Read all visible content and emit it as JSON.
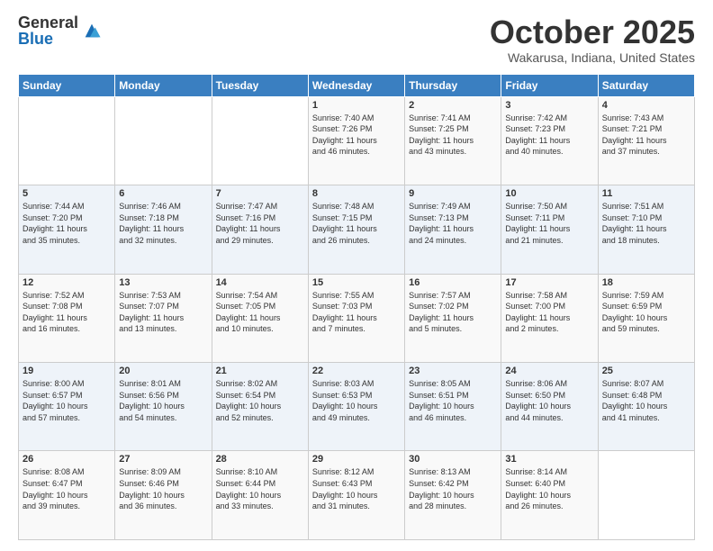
{
  "logo": {
    "general": "General",
    "blue": "Blue"
  },
  "header": {
    "month": "October 2025",
    "location": "Wakarusa, Indiana, United States"
  },
  "weekdays": [
    "Sunday",
    "Monday",
    "Tuesday",
    "Wednesday",
    "Thursday",
    "Friday",
    "Saturday"
  ],
  "weeks": [
    [
      {
        "day": "",
        "info": ""
      },
      {
        "day": "",
        "info": ""
      },
      {
        "day": "",
        "info": ""
      },
      {
        "day": "1",
        "info": "Sunrise: 7:40 AM\nSunset: 7:26 PM\nDaylight: 11 hours\nand 46 minutes."
      },
      {
        "day": "2",
        "info": "Sunrise: 7:41 AM\nSunset: 7:25 PM\nDaylight: 11 hours\nand 43 minutes."
      },
      {
        "day": "3",
        "info": "Sunrise: 7:42 AM\nSunset: 7:23 PM\nDaylight: 11 hours\nand 40 minutes."
      },
      {
        "day": "4",
        "info": "Sunrise: 7:43 AM\nSunset: 7:21 PM\nDaylight: 11 hours\nand 37 minutes."
      }
    ],
    [
      {
        "day": "5",
        "info": "Sunrise: 7:44 AM\nSunset: 7:20 PM\nDaylight: 11 hours\nand 35 minutes."
      },
      {
        "day": "6",
        "info": "Sunrise: 7:46 AM\nSunset: 7:18 PM\nDaylight: 11 hours\nand 32 minutes."
      },
      {
        "day": "7",
        "info": "Sunrise: 7:47 AM\nSunset: 7:16 PM\nDaylight: 11 hours\nand 29 minutes."
      },
      {
        "day": "8",
        "info": "Sunrise: 7:48 AM\nSunset: 7:15 PM\nDaylight: 11 hours\nand 26 minutes."
      },
      {
        "day": "9",
        "info": "Sunrise: 7:49 AM\nSunset: 7:13 PM\nDaylight: 11 hours\nand 24 minutes."
      },
      {
        "day": "10",
        "info": "Sunrise: 7:50 AM\nSunset: 7:11 PM\nDaylight: 11 hours\nand 21 minutes."
      },
      {
        "day": "11",
        "info": "Sunrise: 7:51 AM\nSunset: 7:10 PM\nDaylight: 11 hours\nand 18 minutes."
      }
    ],
    [
      {
        "day": "12",
        "info": "Sunrise: 7:52 AM\nSunset: 7:08 PM\nDaylight: 11 hours\nand 16 minutes."
      },
      {
        "day": "13",
        "info": "Sunrise: 7:53 AM\nSunset: 7:07 PM\nDaylight: 11 hours\nand 13 minutes."
      },
      {
        "day": "14",
        "info": "Sunrise: 7:54 AM\nSunset: 7:05 PM\nDaylight: 11 hours\nand 10 minutes."
      },
      {
        "day": "15",
        "info": "Sunrise: 7:55 AM\nSunset: 7:03 PM\nDaylight: 11 hours\nand 7 minutes."
      },
      {
        "day": "16",
        "info": "Sunrise: 7:57 AM\nSunset: 7:02 PM\nDaylight: 11 hours\nand 5 minutes."
      },
      {
        "day": "17",
        "info": "Sunrise: 7:58 AM\nSunset: 7:00 PM\nDaylight: 11 hours\nand 2 minutes."
      },
      {
        "day": "18",
        "info": "Sunrise: 7:59 AM\nSunset: 6:59 PM\nDaylight: 10 hours\nand 59 minutes."
      }
    ],
    [
      {
        "day": "19",
        "info": "Sunrise: 8:00 AM\nSunset: 6:57 PM\nDaylight: 10 hours\nand 57 minutes."
      },
      {
        "day": "20",
        "info": "Sunrise: 8:01 AM\nSunset: 6:56 PM\nDaylight: 10 hours\nand 54 minutes."
      },
      {
        "day": "21",
        "info": "Sunrise: 8:02 AM\nSunset: 6:54 PM\nDaylight: 10 hours\nand 52 minutes."
      },
      {
        "day": "22",
        "info": "Sunrise: 8:03 AM\nSunset: 6:53 PM\nDaylight: 10 hours\nand 49 minutes."
      },
      {
        "day": "23",
        "info": "Sunrise: 8:05 AM\nSunset: 6:51 PM\nDaylight: 10 hours\nand 46 minutes."
      },
      {
        "day": "24",
        "info": "Sunrise: 8:06 AM\nSunset: 6:50 PM\nDaylight: 10 hours\nand 44 minutes."
      },
      {
        "day": "25",
        "info": "Sunrise: 8:07 AM\nSunset: 6:48 PM\nDaylight: 10 hours\nand 41 minutes."
      }
    ],
    [
      {
        "day": "26",
        "info": "Sunrise: 8:08 AM\nSunset: 6:47 PM\nDaylight: 10 hours\nand 39 minutes."
      },
      {
        "day": "27",
        "info": "Sunrise: 8:09 AM\nSunset: 6:46 PM\nDaylight: 10 hours\nand 36 minutes."
      },
      {
        "day": "28",
        "info": "Sunrise: 8:10 AM\nSunset: 6:44 PM\nDaylight: 10 hours\nand 33 minutes."
      },
      {
        "day": "29",
        "info": "Sunrise: 8:12 AM\nSunset: 6:43 PM\nDaylight: 10 hours\nand 31 minutes."
      },
      {
        "day": "30",
        "info": "Sunrise: 8:13 AM\nSunset: 6:42 PM\nDaylight: 10 hours\nand 28 minutes."
      },
      {
        "day": "31",
        "info": "Sunrise: 8:14 AM\nSunset: 6:40 PM\nDaylight: 10 hours\nand 26 minutes."
      },
      {
        "day": "",
        "info": ""
      }
    ]
  ]
}
